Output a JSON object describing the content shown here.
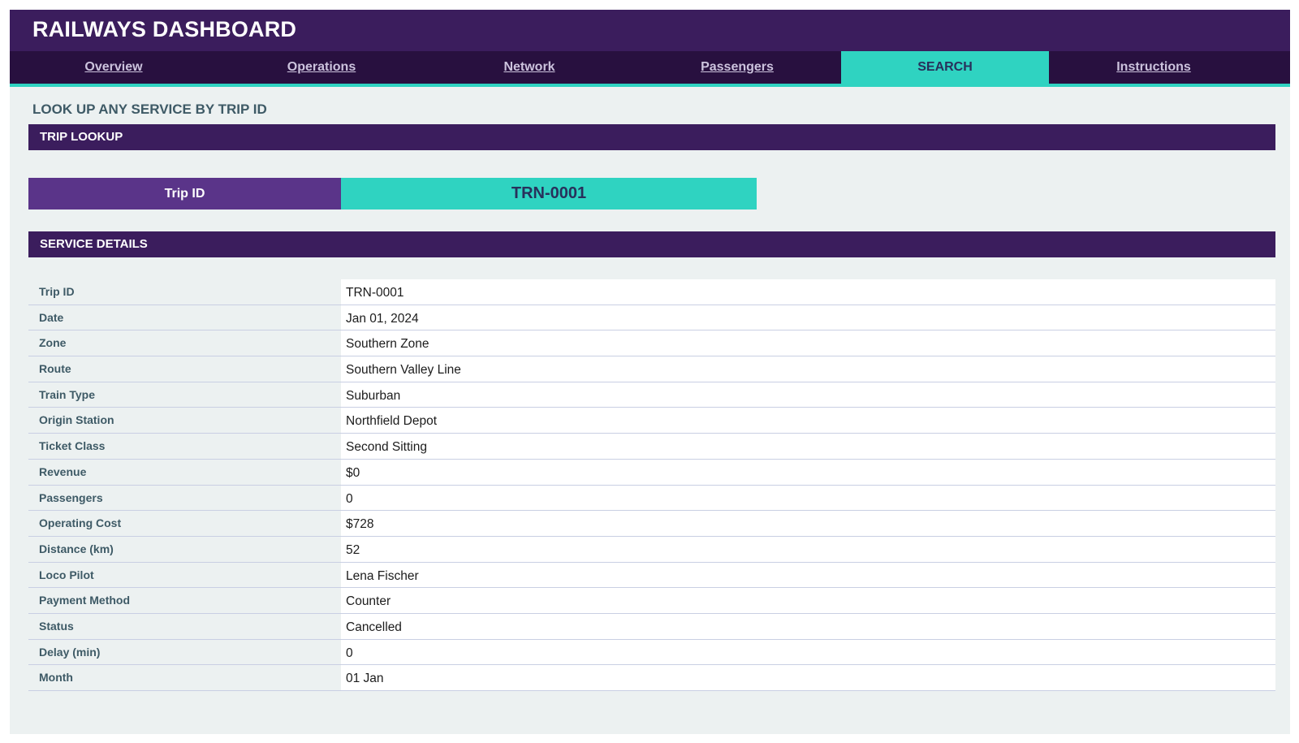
{
  "app": {
    "title": "RAILWAYS DASHBOARD"
  },
  "nav": {
    "tabs": [
      {
        "label": "Overview",
        "active": false
      },
      {
        "label": "Operations",
        "active": false
      },
      {
        "label": "Network",
        "active": false
      },
      {
        "label": "Passengers",
        "active": false
      },
      {
        "label": "SEARCH",
        "active": true
      },
      {
        "label": "Instructions",
        "active": false
      }
    ]
  },
  "page": {
    "subtitle": "LOOK UP ANY SERVICE BY TRIP ID"
  },
  "lookup": {
    "header": "TRIP LOOKUP",
    "label": "Trip ID",
    "value": "TRN-0001"
  },
  "details": {
    "header": "SERVICE DETAILS",
    "rows": [
      {
        "label": "Trip ID",
        "value": "TRN-0001"
      },
      {
        "label": "Date",
        "value": "Jan 01, 2024"
      },
      {
        "label": "Zone",
        "value": "Southern Zone"
      },
      {
        "label": "Route",
        "value": "Southern Valley Line"
      },
      {
        "label": "Train Type",
        "value": "Suburban"
      },
      {
        "label": "Origin Station",
        "value": "Northfield Depot"
      },
      {
        "label": "Ticket Class",
        "value": "Second Sitting"
      },
      {
        "label": "Revenue",
        "value": "$0"
      },
      {
        "label": "Passengers",
        "value": "0"
      },
      {
        "label": "Operating Cost",
        "value": "$728"
      },
      {
        "label": "Distance (km)",
        "value": "52"
      },
      {
        "label": "Loco Pilot",
        "value": "Lena Fischer"
      },
      {
        "label": "Payment Method",
        "value": "Counter"
      },
      {
        "label": "Status",
        "value": "Cancelled"
      },
      {
        "label": "Delay (min)",
        "value": "0"
      },
      {
        "label": "Month",
        "value": "01 Jan"
      }
    ]
  },
  "colors": {
    "primary": "#3b1d5d",
    "nav_dark": "#28103f",
    "accent": "#2fd3c1",
    "label_purple": "#5a3489",
    "background": "#ecf1f1"
  }
}
